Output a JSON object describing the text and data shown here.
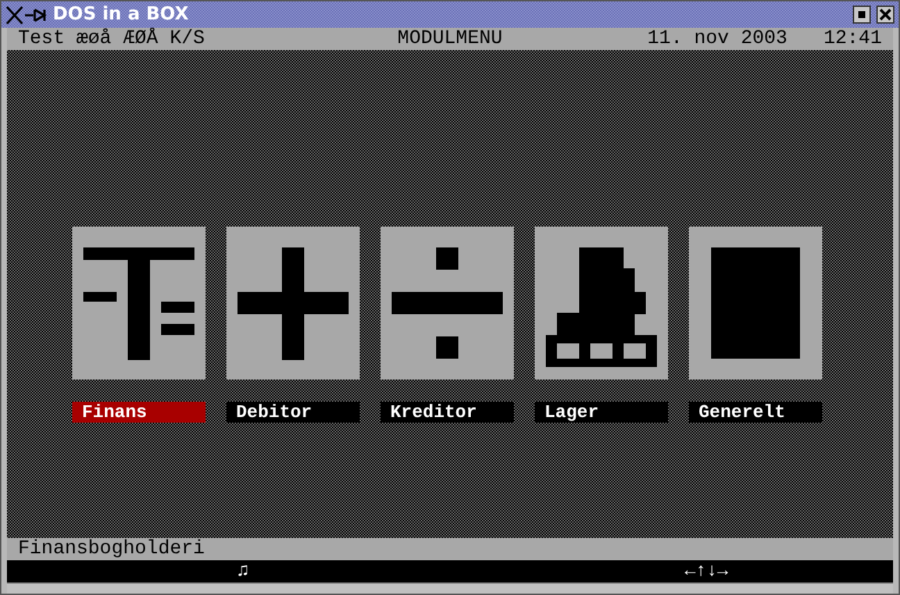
{
  "window": {
    "title": "DOS in a BOX"
  },
  "header": {
    "company": "Test æøå ÆØÅ K/S",
    "screen": "MODULMENU",
    "date": "11. nov 2003",
    "time": "12:41"
  },
  "modules": [
    {
      "label": "Finans",
      "kind": "tee",
      "selected": true
    },
    {
      "label": "Debitor",
      "kind": "plus",
      "selected": false
    },
    {
      "label": "Kreditor",
      "kind": "divide",
      "selected": false
    },
    {
      "label": "Lager",
      "kind": "stack",
      "selected": false
    },
    {
      "label": "Generelt",
      "kind": "block",
      "selected": false
    }
  ],
  "status_text": "Finansbogholderi",
  "footer": {
    "note": "♫",
    "arrows": "←↑↓→"
  }
}
